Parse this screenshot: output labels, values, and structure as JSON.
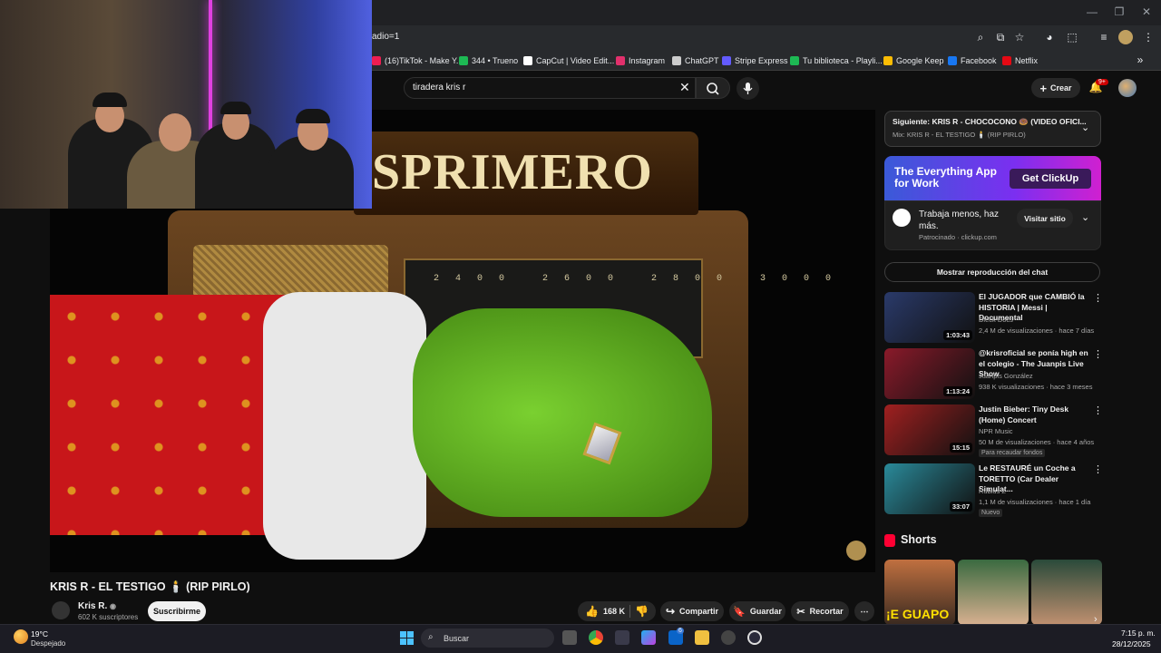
{
  "browser": {
    "url_fragment": "adio=1",
    "bookmarks": [
      {
        "label": "(16)TikTok - Make Y...",
        "color": "#ee1d52"
      },
      {
        "label": "344 • Trueno",
        "color": "#1db954"
      },
      {
        "label": "CapCut | Video Edit...",
        "color": "#ffffff"
      },
      {
        "label": "Instagram",
        "color": "#e1306c"
      },
      {
        "label": "ChatGPT",
        "color": "#cccccc"
      },
      {
        "label": "Stripe Express",
        "color": "#635bff"
      },
      {
        "label": "Tu biblioteca - Playli...",
        "color": "#1db954"
      },
      {
        "label": "Google Keep",
        "color": "#fbbc04"
      },
      {
        "label": "Facebook",
        "color": "#1877f2"
      },
      {
        "label": "Netflix",
        "color": "#e50914"
      }
    ]
  },
  "header": {
    "search_query": "tiradera kris r",
    "create_label": "Crear",
    "notif_badge": "9+"
  },
  "player": {
    "sign_text": "SPRIMERO",
    "dial_numbers": "2400 2600 2800 3000"
  },
  "video": {
    "title": "KRIS R - EL TESTIGO 🕯️ (RIP PIRLO)",
    "channel": "Kris R.",
    "subscribers": "602 K suscriptores",
    "subscribe_label": "Suscribirme",
    "likes": "168 K",
    "share_label": "Compartir",
    "save_label": "Guardar",
    "clip_label": "Recortar"
  },
  "sidebar": {
    "next_title": "Siguiente: KRIS R - CHOCOCONO 🍩 (VIDEO OFICI...",
    "next_sub": "Mix: KRIS R - EL TESTIGO 🕯️ (RIP PIRLO)",
    "ad": {
      "banner_text": "The Everything App for Work",
      "get_label": "Get ClickUp",
      "text": "Trabaja menos, haz más.",
      "sponsor": "Patrocinado · clickup.com",
      "visit_label": "Visitar sitio"
    },
    "chat_replay_label": "Mostrar reproducción del chat",
    "recommendations": [
      {
        "title": "El JUGADOR que CAMBIÓ la HISTORIA | Messi | Documental",
        "channel": "Dieck Docs",
        "meta": "2,4 M de visualizaciones · hace 7 días",
        "duration": "1:03:43",
        "badge": "",
        "thumb_color": "#2a3a6a"
      },
      {
        "title": "@krisroficial se ponía high en el colegio - The Juanpis Live Show",
        "channel": "Juanpis González",
        "meta": "938 K visualizaciones · hace 3 meses",
        "duration": "1:13:24",
        "badge": "",
        "thumb_color": "#8a1a2a"
      },
      {
        "title": "Justin Bieber: Tiny Desk (Home) Concert",
        "channel": "NPR Music",
        "meta": "50 M de visualizaciones · hace 4 años",
        "duration": "15:15",
        "badge": "Para recaudar fondos",
        "thumb_color": "#a02020"
      },
      {
        "title": "Le RESTAURÉ un Coche a TORETTO (Car Dealer Simulat...",
        "channel": "Rubius Z",
        "meta": "1,1 M de visualizaciones · hace 1 día",
        "duration": "33:07",
        "badge": "Nuevo",
        "thumb_color": "#2a8a9a"
      }
    ],
    "shorts_label": "Shorts",
    "shorts_caption": "¡E GUAPO SE"
  },
  "taskbar": {
    "temperature": "19°C",
    "condition": "Despejado",
    "search_placeholder": "Buscar",
    "time": "7:15 p. m.",
    "date": "28/12/2025",
    "mail_badge": "6"
  }
}
